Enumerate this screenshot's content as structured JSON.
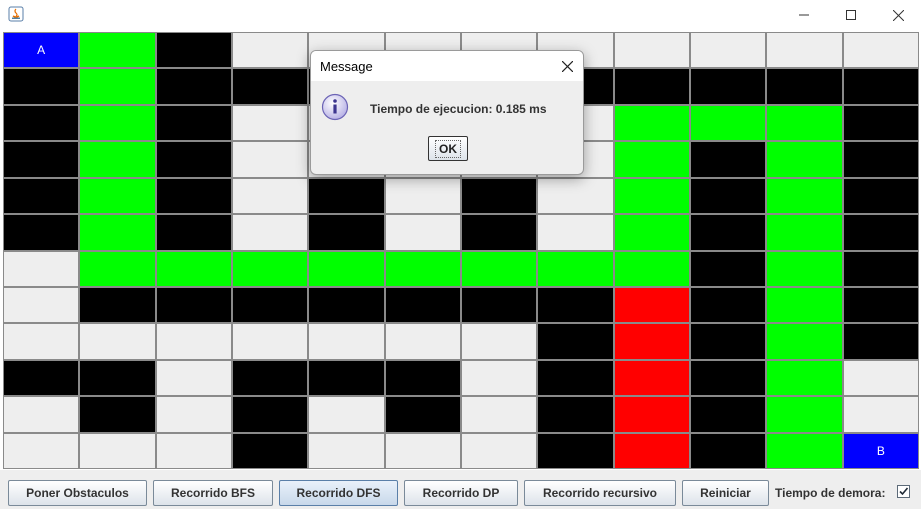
{
  "window": {
    "minimize_icon": "minimize-icon",
    "maximize_icon": "maximize-icon",
    "close_icon": "close-icon",
    "app_icon": "java-icon"
  },
  "grid": {
    "columns": 12,
    "rows": 12,
    "colors": {
      "F": "#eeeeee",
      "W": "#000000",
      "G": "#00ff00",
      "R": "#ff0000",
      "S": "#0000ff",
      "E": "#0000ff"
    },
    "start_label": "A",
    "end_label": "B",
    "cells": [
      [
        "S",
        "G",
        "W",
        "F",
        "F",
        "F",
        "F",
        "F",
        "F",
        "F",
        "F",
        "F"
      ],
      [
        "W",
        "G",
        "W",
        "W",
        "W",
        "W",
        "W",
        "W",
        "W",
        "W",
        "W",
        "W"
      ],
      [
        "W",
        "G",
        "W",
        "F",
        "F",
        "F",
        "F",
        "F",
        "G",
        "G",
        "G",
        "W"
      ],
      [
        "W",
        "G",
        "W",
        "F",
        "F",
        "F",
        "F",
        "F",
        "G",
        "W",
        "G",
        "W"
      ],
      [
        "W",
        "G",
        "W",
        "F",
        "W",
        "F",
        "W",
        "F",
        "G",
        "W",
        "G",
        "W"
      ],
      [
        "W",
        "G",
        "W",
        "F",
        "W",
        "F",
        "W",
        "F",
        "G",
        "W",
        "G",
        "W"
      ],
      [
        "F",
        "G",
        "G",
        "G",
        "G",
        "G",
        "G",
        "G",
        "G",
        "W",
        "G",
        "W"
      ],
      [
        "F",
        "W",
        "W",
        "W",
        "W",
        "W",
        "W",
        "W",
        "R",
        "W",
        "G",
        "W"
      ],
      [
        "F",
        "F",
        "F",
        "F",
        "F",
        "F",
        "F",
        "W",
        "R",
        "W",
        "G",
        "W"
      ],
      [
        "W",
        "W",
        "F",
        "W",
        "W",
        "W",
        "F",
        "W",
        "R",
        "W",
        "G",
        "F"
      ],
      [
        "F",
        "W",
        "F",
        "W",
        "F",
        "W",
        "F",
        "W",
        "R",
        "W",
        "G",
        "F"
      ],
      [
        "F",
        "F",
        "F",
        "W",
        "F",
        "F",
        "F",
        "W",
        "R",
        "W",
        "G",
        "E"
      ]
    ]
  },
  "toolbar": {
    "buttons": [
      {
        "name": "poner-obstaculos-button",
        "label": "Poner Obstaculos",
        "active": false
      },
      {
        "name": "recorrido-bfs-button",
        "label": "Recorrido BFS",
        "active": false
      },
      {
        "name": "recorrido-dfs-button",
        "label": "Recorrido DFS",
        "active": true
      },
      {
        "name": "recorrido-dp-button",
        "label": "Recorrido DP",
        "active": false
      },
      {
        "name": "recorrido-recursivo-button",
        "label": "Recorrido recursivo",
        "active": false
      },
      {
        "name": "reiniciar-button",
        "label": "Reiniciar",
        "active": false
      }
    ],
    "delay_label": "Tiempo de demora:",
    "delay_checked": true
  },
  "dialog": {
    "title": "Message",
    "message": "Tiempo de ejecucion: 0.185 ms",
    "ok_label": "OK",
    "icon": "info-icon"
  }
}
